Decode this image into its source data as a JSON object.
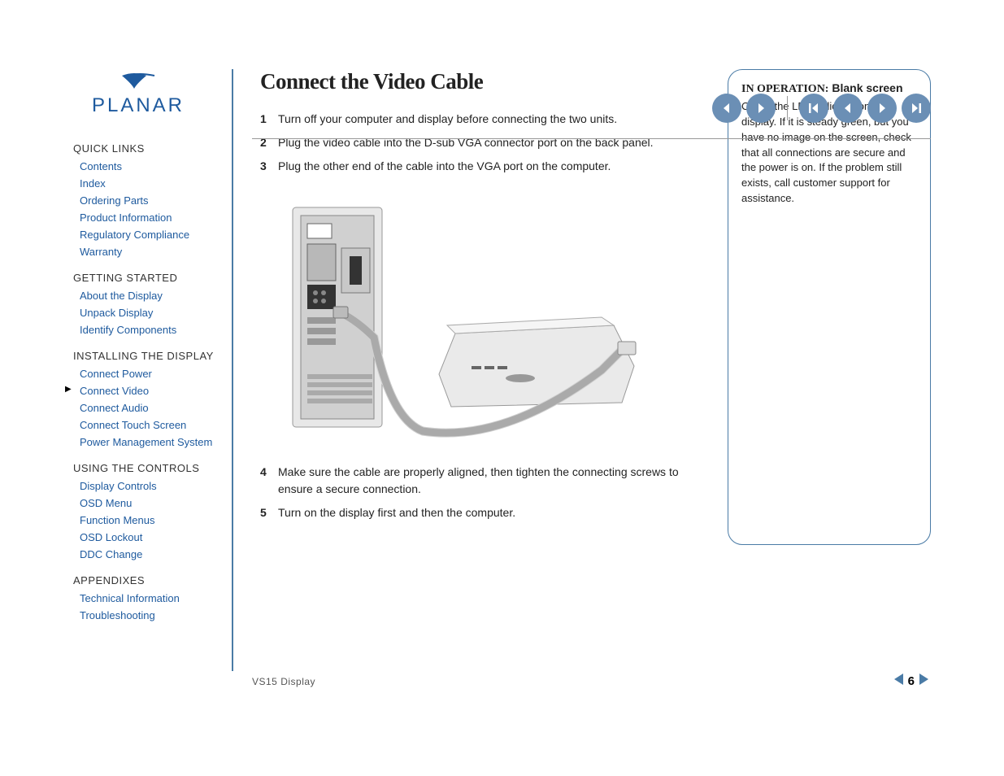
{
  "brand": "PLANAR",
  "nav_buttons": [
    "back",
    "forward",
    "first",
    "prev",
    "next",
    "last"
  ],
  "sidebar": {
    "sections": [
      {
        "heading": "QUICK LINKS",
        "items": [
          "Contents",
          "Index",
          "Ordering Parts",
          "Product Information",
          "Regulatory Compliance",
          "Warranty"
        ]
      },
      {
        "heading": "GETTING STARTED",
        "items": [
          "About the Display",
          "Unpack Display",
          "Identify Components"
        ]
      },
      {
        "heading": "INSTALLING THE DISPLAY",
        "items": [
          "Connect Power",
          "Connect Video",
          "Connect Audio",
          "Connect Touch Screen",
          "Power Management System"
        ],
        "active_index": 1
      },
      {
        "heading": "USING THE CONTROLS",
        "items": [
          "Display Controls",
          "OSD Menu",
          "Function Menus",
          "OSD Lockout",
          "DDC Change"
        ]
      },
      {
        "heading": "APPENDIXES",
        "items": [
          "Technical Information",
          "Troubleshooting"
        ]
      }
    ]
  },
  "content": {
    "title": "Connect the Video Cable",
    "steps": [
      "Turn off your computer and display before connecting the two units.",
      "Plug the video cable into the D-sub VGA connector port on the back panel.",
      "Plug the other end of the cable into the VGA port on the computer.",
      "Make sure the cable are properly aligned, then tighten the connecting screws to ensure a secure connection.",
      "Turn on the display first and then the computer."
    ]
  },
  "callout": {
    "prefix": "IN OPERATION:",
    "suffix": "Blank screen",
    "text": "Check the LED indicator on the display. If it is steady green, but you have no image on the screen, check that all connections are secure and the power is on. If the problem still exists, call customer support for assistance."
  },
  "footer": {
    "product": "VS15 Display",
    "page": "6"
  }
}
